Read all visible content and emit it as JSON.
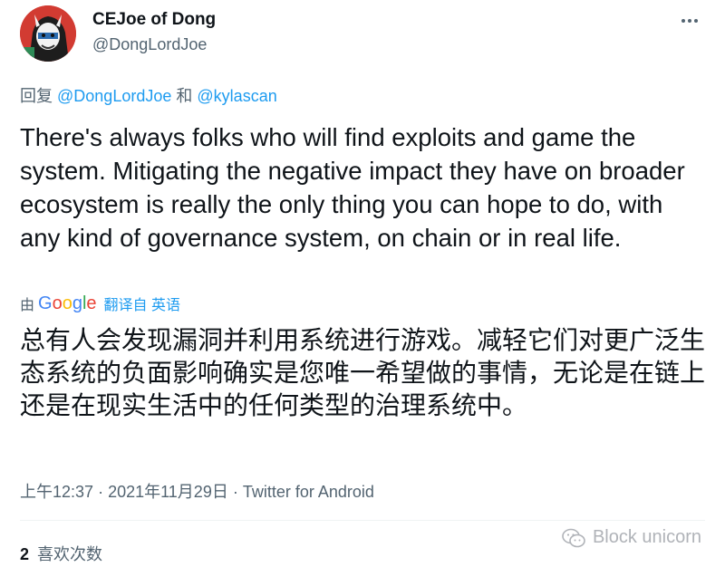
{
  "author": {
    "display_name": "CEJoe of Dong",
    "handle": "@DongLordJoe"
  },
  "reply": {
    "prefix": "回复",
    "user1": "@DongLordJoe",
    "joiner": "和",
    "user2": "@kylascan"
  },
  "tweet": {
    "text": "There's always folks who will find exploits and game the system. Mitigating the negative impact they have on broader ecosystem is really the only thing you can hope to do, with any kind of governance system, on chain or in real life."
  },
  "translation": {
    "by_label": "由",
    "provider": "Google",
    "action_label": "翻译自 英语",
    "text": "总有人会发现漏洞并利用系统进行游戏。减轻它们对更广泛生态系统的负面影响确实是您唯一希望做的事情，无论是在链上还是在现实生活中的任何类型的治理系统中。"
  },
  "meta": {
    "time": "上午12:37",
    "date": "2021年11月29日",
    "separator": "·",
    "source": "Twitter for Android"
  },
  "stats": {
    "likes_count": "2",
    "likes_label": "喜欢次数"
  },
  "watermark": {
    "text": "Block unicorn"
  },
  "icons": {
    "more": "more-horizontal-icon",
    "watermark": "wechat-icon"
  },
  "colors": {
    "link": "#1d9bf0",
    "secondary_text": "#536471",
    "primary_text": "#0f1419"
  }
}
